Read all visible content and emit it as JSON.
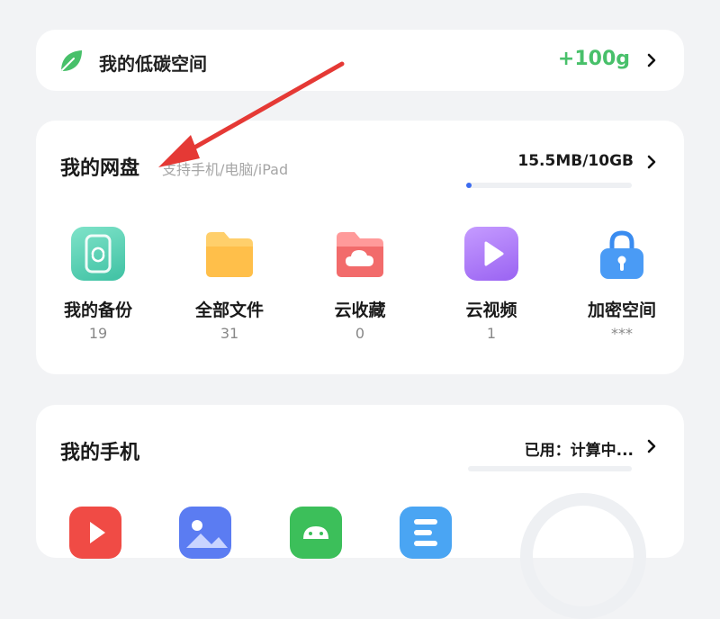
{
  "carbon": {
    "title": "我的低碳空间",
    "value": "+100g",
    "accent": "#48c06a",
    "icon": "leaf-icon"
  },
  "cloud_drive": {
    "title": "我的网盘",
    "subtitle": "支持手机/电脑/iPad",
    "usage": "15.5MB/10GB",
    "progress_fraction": 0.02,
    "items": [
      {
        "label": "我的备份",
        "count": "19",
        "icon": "backup-phone-icon"
      },
      {
        "label": "全部文件",
        "count": "31",
        "icon": "folder-icon"
      },
      {
        "label": "云收藏",
        "count": "0",
        "icon": "cloud-favorite-icon"
      },
      {
        "label": "云视频",
        "count": "1",
        "icon": "video-play-icon"
      },
      {
        "label": "加密空间",
        "count": "***",
        "icon": "lock-icon"
      }
    ]
  },
  "my_phone": {
    "title": "我的手机",
    "status": "已用：计算中...",
    "apps": [
      "video-app-icon",
      "gallery-app-icon",
      "android-app-icon",
      "documents-app-icon"
    ]
  },
  "annotation": {
    "color": "#e53935",
    "icon": "red-arrow-annotation"
  }
}
